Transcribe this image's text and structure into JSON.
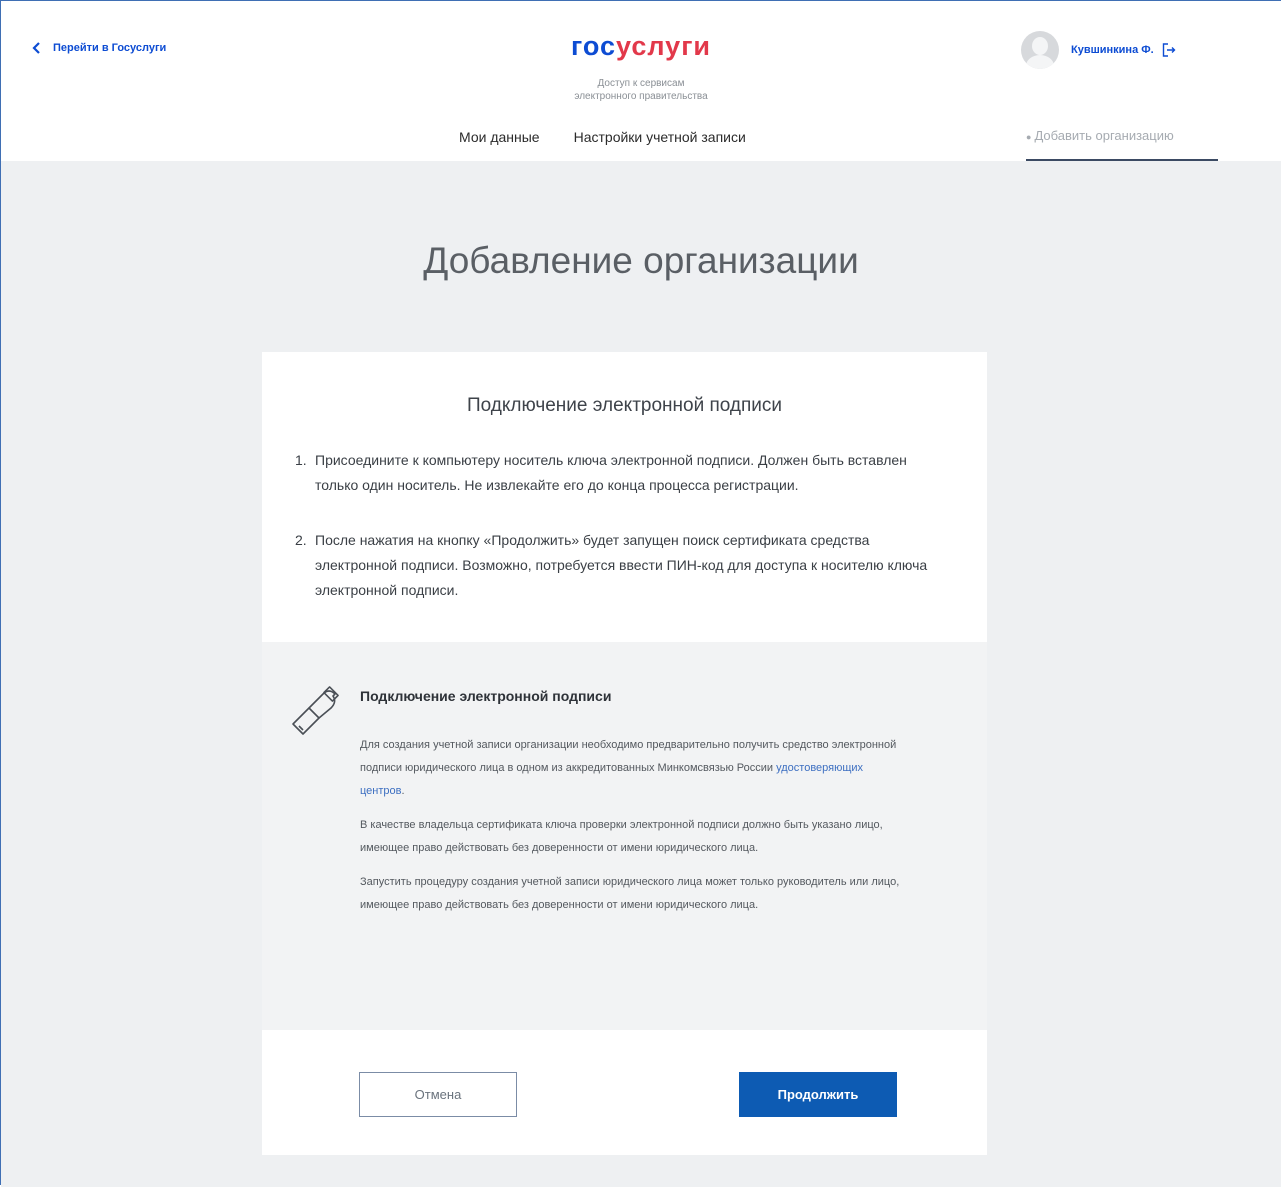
{
  "header": {
    "back_link": "Перейти в Госуслуги",
    "logo_part1": "гос",
    "logo_part2": "услуги",
    "subtitle_line1": "Доступ к сервисам",
    "subtitle_line2": "электронного правительства",
    "user_name": "Кувшинкина Ф."
  },
  "nav": {
    "items": [
      {
        "label": "Мои данные"
      },
      {
        "label": "Настройки учетной записи"
      }
    ],
    "add_org_tab": "Добавить организацию"
  },
  "main": {
    "title": "Добавление организации",
    "card_title": "Подключение электронной подписи",
    "steps": [
      {
        "num": "1.",
        "text": "Присоедините к компьютеру носитель ключа электронной подписи. Должен быть вставлен только один носитель. Не извлекайте его до конца процесса регистрации."
      },
      {
        "num": "2.",
        "text": "После нажатия на кнопку «Продолжить» будет запущен поиск сертификата средства электронной подписи. Возможно, потребуется ввести ПИН-код для доступа к носителю ключа электронной подписи."
      }
    ],
    "info": {
      "title": "Подключение электронной подписи",
      "para1_text": "Для создания учетной записи организации необходимо предварительно получить средство электронной подписи юридического лица в одном из аккредитованных Минкомсвязью России",
      "para1_link": "удостоверяющих центров",
      "para1_end": ".",
      "para2": "В качестве владельца сертификата ключа проверки электронной подписи должно быть указано лицо, имеющее право действовать без доверенности от имени юридического лица.",
      "para3": "Запустить процедуру создания учетной записи юридического лица может только руководитель или лицо, имеющее право действовать без доверенности от имени юридического лица."
    }
  },
  "actions": {
    "cancel": "Отмена",
    "continue": "Продолжить"
  },
  "colors": {
    "brand_blue": "#0d4cd3",
    "brand_red": "#e2384a",
    "primary_button": "#0d5bb3",
    "background": "#eef0f2"
  }
}
